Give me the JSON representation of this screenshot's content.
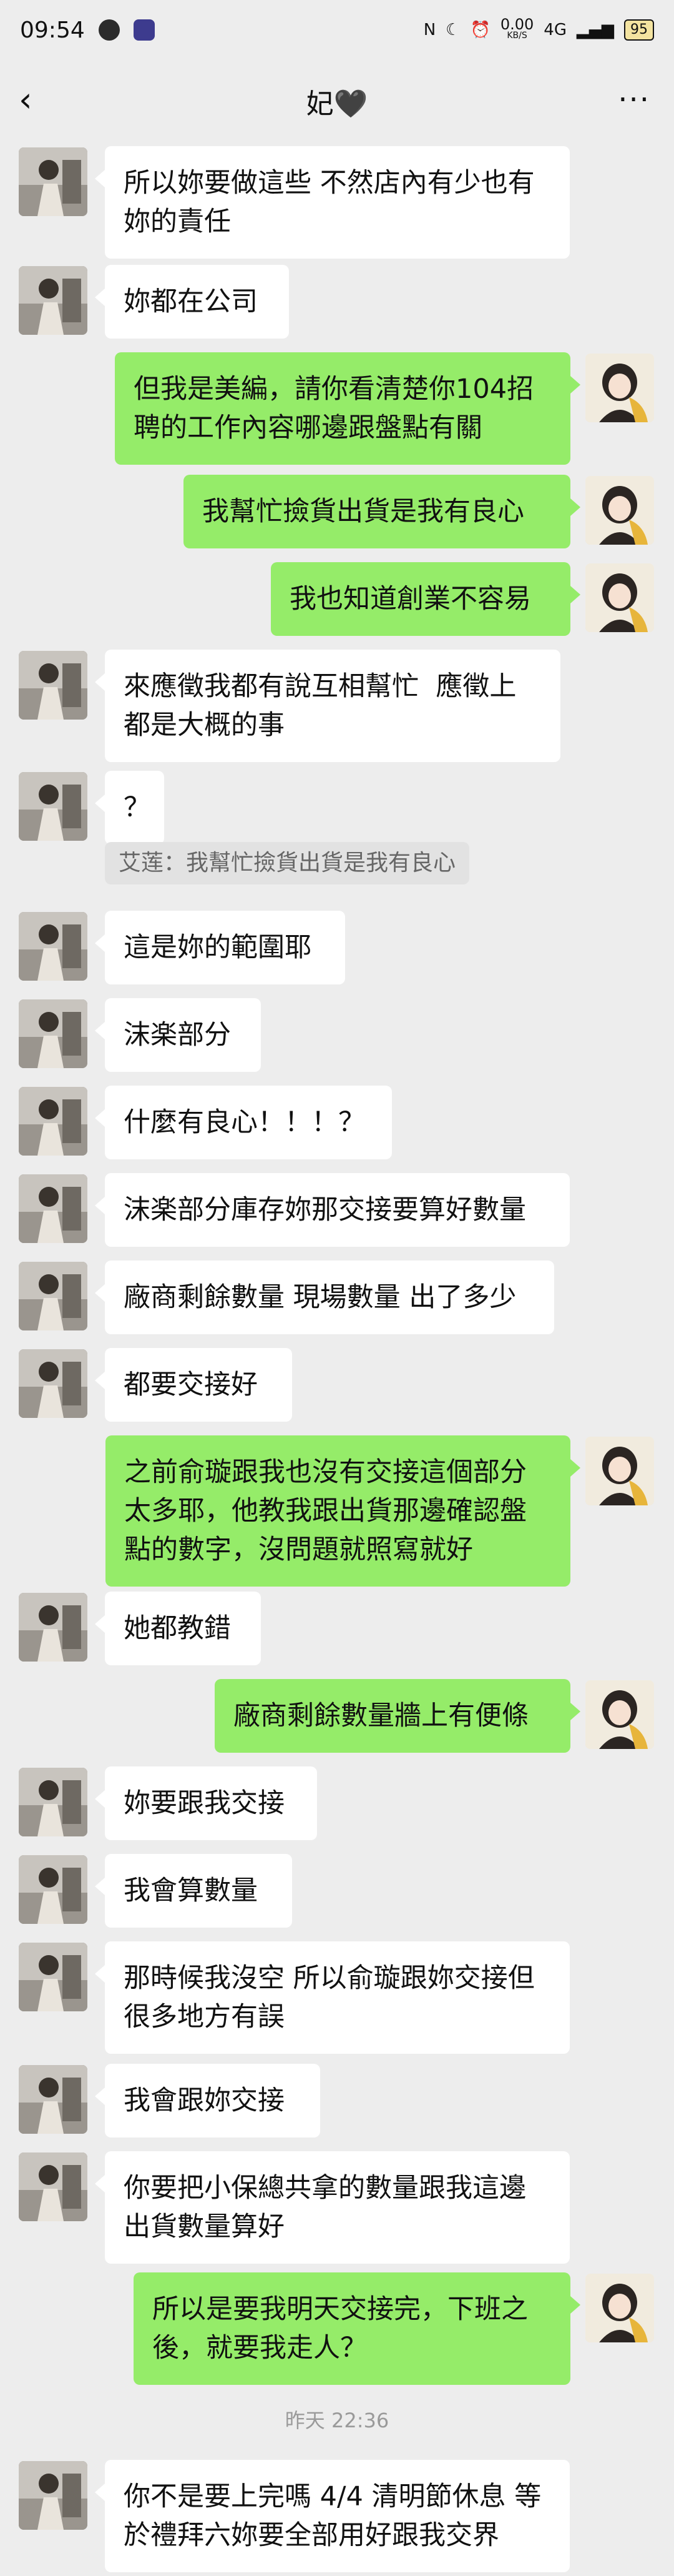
{
  "status_bar": {
    "time": "09:54",
    "network_speed": "0.00",
    "network_unit": "KB/S",
    "signal": "4G",
    "battery": "95"
  },
  "header": {
    "title": "妃🖤"
  },
  "messages": [
    {
      "side": "left",
      "text": "所以妳要做這些 不然店內有少也有妳的責任"
    },
    {
      "side": "left",
      "text": "妳都在公司"
    },
    {
      "side": "right",
      "text": "但我是美編，請你看清楚你104招聘的工作內容哪邊跟盤點有關"
    },
    {
      "side": "right",
      "text": "我幫忙撿貨出貨是我有良心"
    },
    {
      "side": "right",
      "text": "我也知道創業不容易"
    },
    {
      "side": "left",
      "text": "來應徵我都有說互相幫忙  應徵上都是大概的事"
    },
    {
      "side": "left",
      "text": "？"
    },
    {
      "side": "left",
      "text": "這是妳的範圍耶"
    },
    {
      "side": "left",
      "text": "沫楽部分"
    },
    {
      "side": "left",
      "text": "什麼有良心！！！？"
    },
    {
      "side": "left",
      "text": "沫楽部分庫存妳那交接要算好數量"
    },
    {
      "side": "left",
      "text": "廠商剩餘數量 現場數量 出了多少"
    },
    {
      "side": "left",
      "text": "都要交接好"
    },
    {
      "side": "right",
      "text": "之前俞璇跟我也沒有交接這個部分太多耶，他教我跟出貨那邊確認盤點的數字，沒問題就照寫就好"
    },
    {
      "side": "left",
      "text": "她都教錯"
    },
    {
      "side": "right",
      "text": "廠商剩餘數量牆上有便條"
    },
    {
      "side": "left",
      "text": "妳要跟我交接"
    },
    {
      "side": "left",
      "text": "我會算數量"
    },
    {
      "side": "left",
      "text": "那時候我沒空 所以俞璇跟妳交接但很多地方有誤"
    },
    {
      "side": "left",
      "text": "我會跟妳交接"
    },
    {
      "side": "left",
      "text": "你要把小保總共拿的數量跟我這邊出貨數量算好"
    },
    {
      "side": "right",
      "text": "所以是要我明天交接完，下班之後，就要我走人？"
    },
    {
      "side": "left",
      "text": "你不是要上完嗎 4/4 清明節休息 等於禮拜六妳要全部用好跟我交界"
    }
  ],
  "quote": "艾莲：我幫忙撿貨出貨是我有良心",
  "timestamp": "昨天 22:36",
  "colors": {
    "background": "#ededed",
    "sent_bubble": "#95ec69",
    "received_bubble": "#ffffff"
  }
}
